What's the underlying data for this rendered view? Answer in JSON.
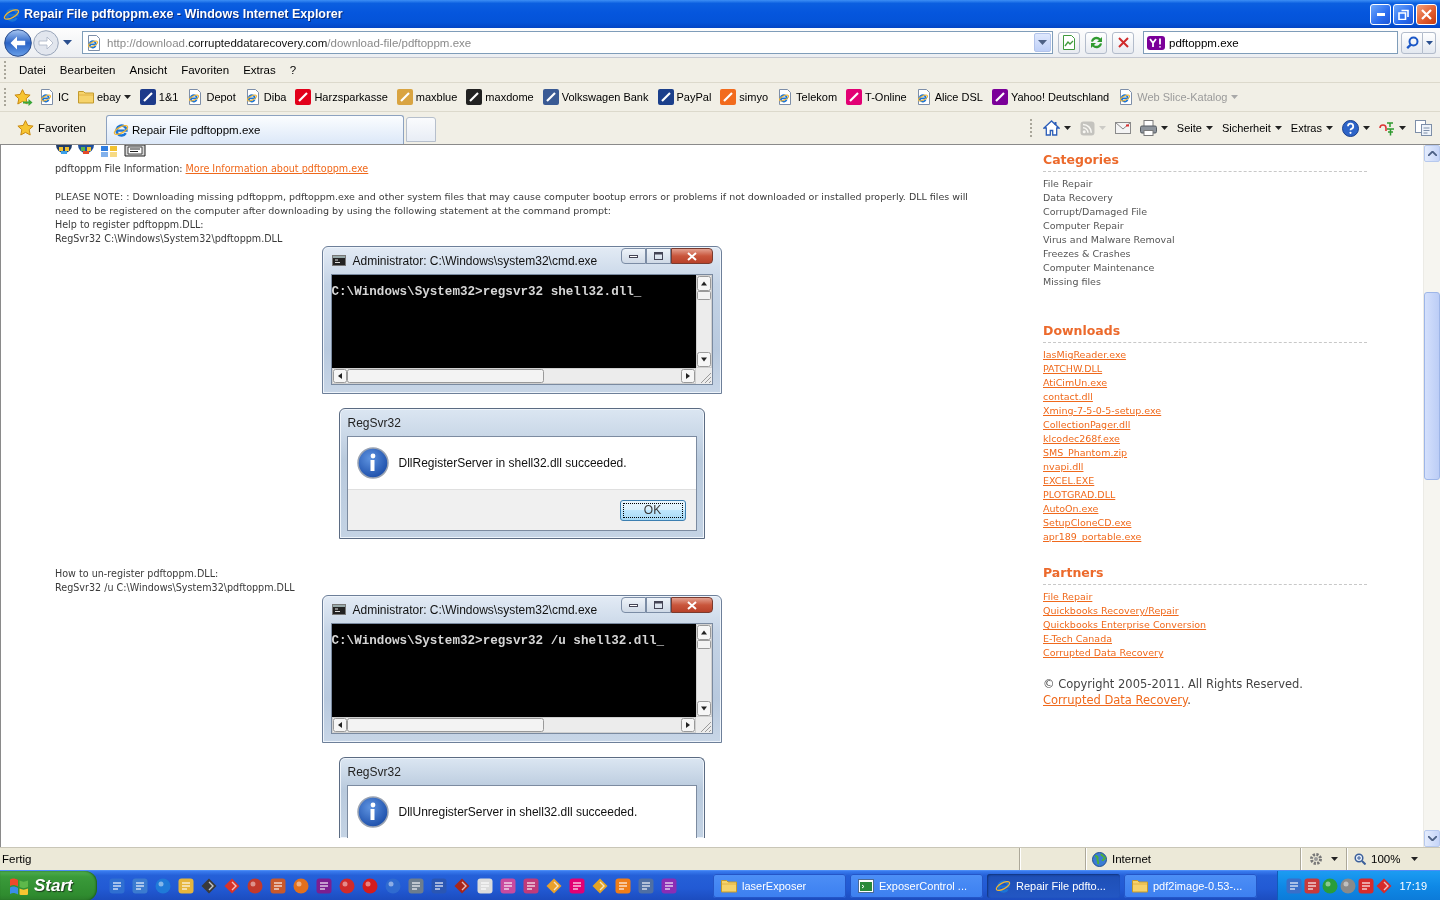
{
  "window": {
    "title": "Repair File pdftoppm.exe - Windows Internet Explorer"
  },
  "address_bar": {
    "url": [
      {
        "text": "http://download.",
        "kind": "dim"
      },
      {
        "text": "corrupteddatarecovery.com",
        "kind": "host"
      },
      {
        "text": "/download-file/pdftoppm.exe",
        "kind": "dim"
      }
    ]
  },
  "search_box": {
    "value": "pdftoppm.exe"
  },
  "menu_bar": [
    "Datei",
    "Bearbeiten",
    "Ansicht",
    "Favoriten",
    "Extras",
    "?"
  ],
  "favorites_bar": [
    {
      "label": "IC",
      "kind": "page",
      "dropdown": false,
      "disabled": false
    },
    {
      "label": "ebay",
      "kind": "folder",
      "dropdown": true,
      "disabled": false
    },
    {
      "label": "1&1",
      "kind": "tile",
      "color": "#1c3a8a",
      "dropdown": false,
      "disabled": false
    },
    {
      "label": "Depot",
      "kind": "page",
      "dropdown": false,
      "disabled": false
    },
    {
      "label": "Diba",
      "kind": "page",
      "dropdown": false,
      "disabled": false
    },
    {
      "label": "Harzsparkasse",
      "kind": "tile",
      "color": "#e2001a",
      "dropdown": false,
      "disabled": false
    },
    {
      "label": "maxblue",
      "kind": "tile",
      "color": "#d9a441",
      "dropdown": false,
      "disabled": false
    },
    {
      "label": "maxdome",
      "kind": "tile",
      "color": "#222222",
      "dropdown": false,
      "disabled": false
    },
    {
      "label": "Volkswagen Bank",
      "kind": "tile",
      "color": "#3a5a94",
      "dropdown": false,
      "disabled": false
    },
    {
      "label": "PayPal",
      "kind": "tile",
      "color": "#1b3f8b",
      "dropdown": false,
      "disabled": false
    },
    {
      "label": "simyo",
      "kind": "tile",
      "color": "#f26b1d",
      "dropdown": false,
      "disabled": false
    },
    {
      "label": "Telekom",
      "kind": "page",
      "dropdown": false,
      "disabled": false
    },
    {
      "label": "T-Online",
      "kind": "tile",
      "color": "#e20074",
      "dropdown": false,
      "disabled": false
    },
    {
      "label": "Alice DSL",
      "kind": "page",
      "dropdown": false,
      "disabled": false
    },
    {
      "label": "Yahoo! Deutschland",
      "kind": "tile",
      "color": "#7b0099",
      "dropdown": false,
      "disabled": false
    },
    {
      "label": "Web Slice-Katalog",
      "kind": "page",
      "dropdown": true,
      "disabled": true
    }
  ],
  "favorites_button": "Favoriten",
  "tabs": [
    {
      "label": "Repair File pdftoppm.exe",
      "selected": true
    }
  ],
  "command_bar": [
    {
      "kind": "home",
      "dropdown": true,
      "disabled": false
    },
    {
      "kind": "feeds",
      "dropdown": true,
      "disabled": true
    },
    {
      "kind": "mail",
      "dropdown": false,
      "disabled": false
    },
    {
      "kind": "print",
      "dropdown": true,
      "disabled": false
    },
    {
      "kind": "menu",
      "label": "Seite",
      "dropdown": true,
      "disabled": false
    },
    {
      "kind": "menu",
      "label": "Sicherheit",
      "dropdown": true,
      "disabled": false
    },
    {
      "kind": "menu",
      "label": "Extras",
      "dropdown": true,
      "disabled": false
    },
    {
      "kind": "help",
      "dropdown": true,
      "disabled": false
    },
    {
      "kind": "translate",
      "dropdown": true,
      "disabled": false
    },
    {
      "kind": "research",
      "dropdown": false,
      "disabled": false
    }
  ],
  "page": {
    "file_info": {
      "label": "pdftoppm File Information:",
      "link": "More Information about pdftoppm.exe"
    },
    "note": "PLEASE NOTE: : Downloading missing pdftoppm, pdftoppm.exe and other system files that may cause computer bootup errors or problems if not downloaded or installed properly. DLL files will need to be registered on the computer after downloading by using the following statement at the command prompt:",
    "steps": [
      {
        "heading": "Help to register pdftoppm.DLL:",
        "command": "RegSvr32 C:\\Windows\\System32\\pdftoppm.DLL",
        "console": {
          "title": "Administrator: C:\\Windows\\system32\\cmd.exe",
          "line": "C:\\Windows\\System32>regsvr32 shell32.dll_"
        },
        "dialog": {
          "title": "RegSvr32",
          "message": "DllRegisterServer in shell32.dll succeeded.",
          "button": {
            "label": "OK",
            "focused": true
          }
        }
      },
      {
        "heading": "How to un-register pdftoppm.DLL:",
        "command": "RegSvr32 /u C:\\Windows\\System32\\pdftoppm.DLL",
        "console": {
          "title": "Administrator: C:\\Windows\\system32\\cmd.exe",
          "line": "C:\\Windows\\System32>regsvr32 /u shell32.dll_"
        },
        "dialog": {
          "title": "RegSvr32",
          "message": "DllUnregisterServer in shell32.dll succeeded."
        }
      }
    ]
  },
  "sidebar": {
    "sections": [
      {
        "title": "Categories",
        "kind": "text",
        "items": [
          "File Repair",
          "Data Recovery",
          "Corrupt/Damaged File",
          "Computer Repair",
          "Virus and Malware Removal",
          "Freezes & Crashes",
          "Computer Maintenance",
          "Missing files"
        ]
      },
      {
        "title": "Downloads",
        "kind": "links",
        "items": [
          "IasMigReader.exe",
          "PATCHW.DLL",
          "AtiCimUn.exe",
          "contact.dll",
          "Xming-7-5-0-5-setup.exe",
          "CollectionPager.dll",
          "klcodec268f.exe",
          "SMS_Phantom.zip",
          "nvapi.dll",
          "EXCEL.EXE",
          "PLOTGRAD.DLL",
          "AutoOn.exe",
          "SetupCloneCD.exe",
          "apr189_portable.exe"
        ]
      },
      {
        "title": "Partners",
        "kind": "links",
        "items": [
          "File Repair",
          "Quickbooks Recovery/Repair",
          "Quickbooks Enterprise Conversion",
          "E-Tech Canada",
          "Corrupted Data Recovery"
        ]
      }
    ],
    "copyright": "© Copyright 2005-2011. All Rights Reserved.",
    "footer": {
      "link": "Corrupted Data Recovery",
      "after": "."
    }
  },
  "status_bar": {
    "text": "Fertig",
    "zone": "Internet",
    "zoom": "100%"
  },
  "taskbar": {
    "start": "Start",
    "tasks": [
      {
        "label": "laserExposer",
        "kind": "folder",
        "selected": false
      },
      {
        "label": "ExposerControl ...",
        "kind": "console",
        "selected": false
      },
      {
        "label": "Repair File pdfto...",
        "kind": "browser",
        "selected": true
      },
      {
        "label": "pdf2image-0.53-...",
        "kind": "folder",
        "selected": false
      }
    ],
    "clock": "17:19"
  }
}
